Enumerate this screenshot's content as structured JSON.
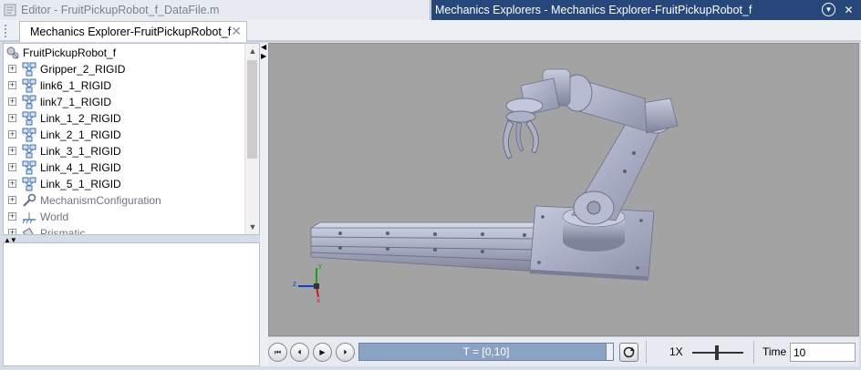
{
  "titlebar_left": {
    "title": "Editor - FruitPickupRobot_f_DataFile.m"
  },
  "titlebar_right": {
    "title": "Mechanics Explorers - Mechanics Explorer-FruitPickupRobot_f",
    "menu_icon": "chevron-down-circle-icon",
    "close_icon": "close-icon"
  },
  "tab": {
    "label": "Mechanics Explorer-FruitPickupRobot_f",
    "close": "✕"
  },
  "tree": {
    "root": "FruitPickupRobot_f",
    "items": [
      {
        "label": "Gripper_2_RIGID",
        "icon": "rigid-body-icon"
      },
      {
        "label": "link6_1_RIGID",
        "icon": "rigid-body-icon"
      },
      {
        "label": "link7_1_RIGID",
        "icon": "rigid-body-icon"
      },
      {
        "label": "Link_1_2_RIGID",
        "icon": "rigid-body-icon"
      },
      {
        "label": "Link_2_1_RIGID",
        "icon": "rigid-body-icon"
      },
      {
        "label": "Link_3_1_RIGID",
        "icon": "rigid-body-icon"
      },
      {
        "label": "Link_4_1_RIGID",
        "icon": "rigid-body-icon"
      },
      {
        "label": "Link_5_1_RIGID",
        "icon": "rigid-body-icon"
      },
      {
        "label": "MechanismConfiguration",
        "icon": "wrench-icon"
      },
      {
        "label": "World",
        "icon": "world-frame-icon"
      },
      {
        "label": "Prismatic",
        "icon": "prismatic-joint-icon"
      }
    ]
  },
  "viewport": {
    "triad": {
      "x": "x",
      "y": "y",
      "z": "z"
    },
    "colors": {
      "background": "#a3a3a3",
      "body": "#aeb2c8",
      "x_axis": "#d01818",
      "y_axis": "#18a018",
      "z_axis": "#1838d0"
    }
  },
  "playback": {
    "timeline_label": "T = [0,10]",
    "speed": "1X",
    "time_label": "Time",
    "time_value": "10"
  }
}
